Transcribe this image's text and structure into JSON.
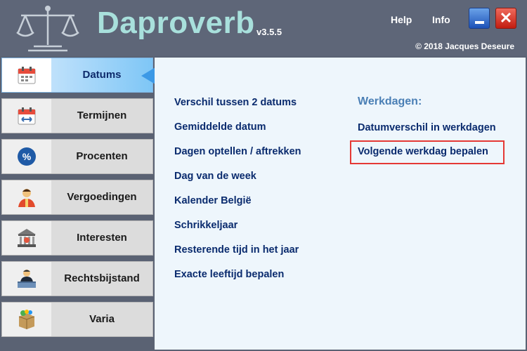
{
  "app": {
    "title": "Daproverb",
    "version": "v3.5.5",
    "copyright": "© 2018 Jacques Deseure"
  },
  "header": {
    "help": "Help",
    "info": "Info",
    "close_symbol": "✕"
  },
  "sidebar": {
    "items": [
      {
        "label": "Datums",
        "icon": "calendar-icon",
        "active": true
      },
      {
        "label": "Termijnen",
        "icon": "calendar-arrows-icon",
        "active": false
      },
      {
        "label": "Procenten",
        "icon": "percent-icon",
        "active": false
      },
      {
        "label": "Vergoedingen",
        "icon": "person-icon",
        "active": false
      },
      {
        "label": "Interesten",
        "icon": "bank-icon",
        "active": false
      },
      {
        "label": "Rechtsbijstand",
        "icon": "lawyer-icon",
        "active": false
      },
      {
        "label": "Varia",
        "icon": "box-icon",
        "active": false
      }
    ]
  },
  "main": {
    "left_links": [
      "Verschil tussen 2 datums",
      "Gemiddelde datum",
      "Dagen optellen / aftrekken",
      "Dag van de week",
      "Kalender België",
      "Schrikkeljaar",
      "Resterende tijd in het jaar",
      "Exacte leeftijd bepalen"
    ],
    "werkdagen": {
      "heading": "Werkdagen:",
      "links": [
        "Datumverschil in werkdagen",
        "Volgende werkdag bepalen"
      ]
    }
  },
  "colors": {
    "header_bg": "#5e6678",
    "title": "#a8e0dc",
    "link": "#0a2b6e",
    "heading": "#4a7fb5",
    "highlight": "#e53935",
    "pointer": "#3c99e6"
  }
}
